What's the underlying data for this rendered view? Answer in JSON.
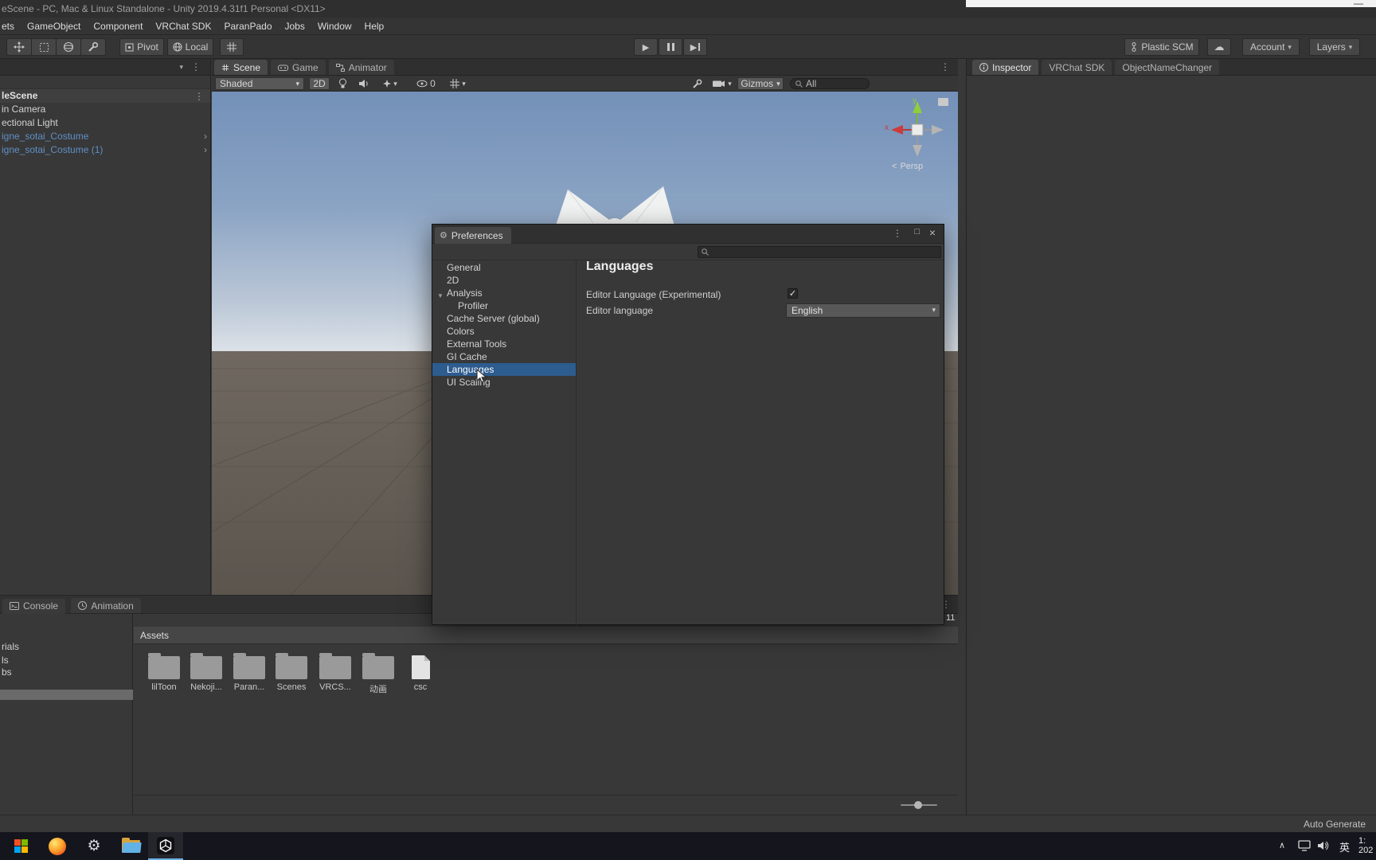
{
  "window": {
    "title": "eScene - PC, Mac & Linux Standalone - Unity 2019.4.31f1 Personal <DX11>",
    "minimize": "—"
  },
  "menubar": {
    "items": [
      {
        "label": "ets"
      },
      {
        "label": "GameObject"
      },
      {
        "label": "Component"
      },
      {
        "label": "VRChat SDK"
      },
      {
        "label": "ParanPado"
      },
      {
        "label": "Jobs"
      },
      {
        "label": "Window"
      },
      {
        "label": "Help"
      }
    ]
  },
  "toolbar": {
    "pivot": "Pivot",
    "local": "Local",
    "plastic_scm": "Plastic SCM",
    "account": "Account",
    "layers": "Layers"
  },
  "hierarchy": {
    "scene_header": "leScene",
    "items": [
      {
        "label": "in Camera"
      },
      {
        "label": "ectional Light"
      },
      {
        "label": "igne_sotai_Costume"
      },
      {
        "label": "igne_sotai_Costume (1)"
      }
    ]
  },
  "scene": {
    "tabs": [
      {
        "label": "Scene"
      },
      {
        "label": "Game"
      },
      {
        "label": "Animator"
      }
    ],
    "shaded": "Shaded",
    "toggle_2d": "2D",
    "visibility_count": "0",
    "gizmos": "Gizmos",
    "search_filter": "All",
    "axis_x": "x",
    "axis_y": "y",
    "persp": "Persp"
  },
  "inspector": {
    "tabs": [
      {
        "label": "Inspector"
      },
      {
        "label": "VRChat SDK"
      },
      {
        "label": "ObjectNameChanger"
      }
    ]
  },
  "preferences": {
    "title": "Preferences",
    "sidebar": [
      {
        "label": "General"
      },
      {
        "label": "2D"
      },
      {
        "label": "Analysis"
      },
      {
        "label": "Profiler"
      },
      {
        "label": "Cache Server (global)"
      },
      {
        "label": "Colors"
      },
      {
        "label": "External Tools"
      },
      {
        "label": "GI Cache"
      },
      {
        "label": "Languages"
      },
      {
        "label": "UI Scaling"
      }
    ],
    "heading": "Languages",
    "row1_label": "Editor Language (Experimental)",
    "row2_label": "Editor language",
    "language_value": "English"
  },
  "bottom_bar": {
    "console": "Console",
    "animation": "Animation",
    "badge": "11"
  },
  "project": {
    "favorites": [
      {
        "label": "rials"
      },
      {
        "label": "ls"
      },
      {
        "label": "bs"
      }
    ],
    "breadcrumb": "Assets",
    "items": [
      {
        "label": "lilToon"
      },
      {
        "label": "Nekoji..."
      },
      {
        "label": "Paran..."
      },
      {
        "label": "Scenes"
      },
      {
        "label": "VRCS..."
      },
      {
        "label": "动画"
      },
      {
        "label": "csc"
      }
    ]
  },
  "statusbar": {
    "auto_generate": "Auto Generate"
  },
  "taskbar": {
    "ime": "英",
    "clock_line1": "1:",
    "clock_line2": "202"
  },
  "icons": {
    "gear": "⚙",
    "cloud": "☁",
    "play": "▶",
    "dropdown": "▾",
    "more": "⋮",
    "close": "×",
    "maximize": "□",
    "check": "✓",
    "chevron": "›",
    "foldout": "▼",
    "tray_up": "∧",
    "persp_lt": "<"
  },
  "colors": {
    "selection_blue": "#2d5c8f",
    "prefab_text": "#5f8fc6",
    "panel_bg": "#383838"
  }
}
